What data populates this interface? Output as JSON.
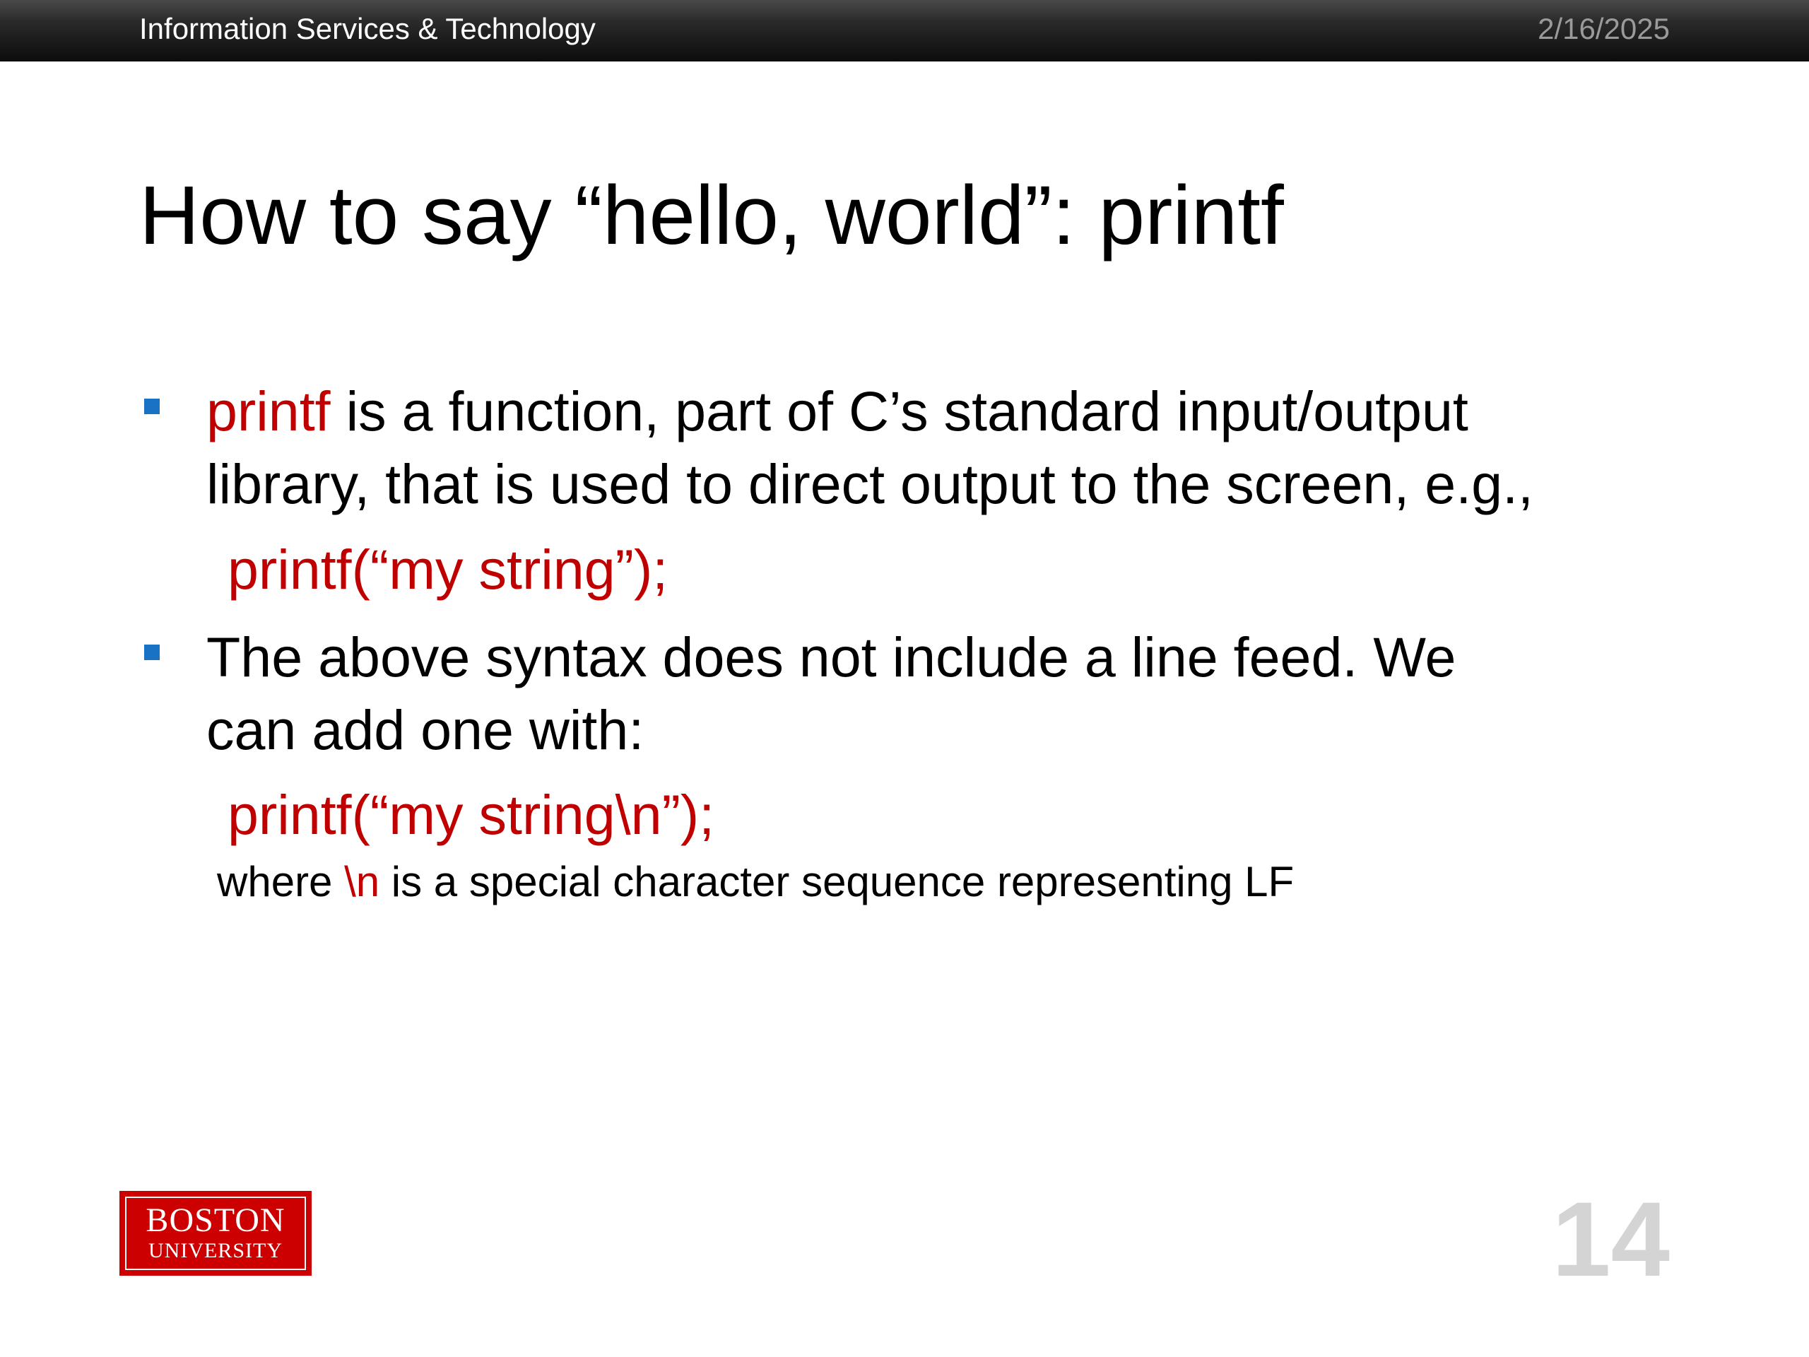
{
  "header": {
    "org_name": "Information Services & Technology",
    "date": "2/16/2025"
  },
  "title": "How to say “hello, world”: printf",
  "bullets": [
    {
      "keyword": "printf",
      "line1_rest": " is a function, part of C’s standard input/output",
      "line2": "library, that is used to direct output to the screen, e.g.,",
      "code": "printf(“my string”);"
    },
    {
      "line1": "The above syntax does not include a line feed.  We",
      "line2": "can add one with:",
      "code": "printf(“my string\\n”);"
    }
  ],
  "note": {
    "prefix": "where ",
    "keyword": "\\n",
    "suffix": " is a special character sequence representing LF"
  },
  "logo": {
    "line1": "BOSTON",
    "line2": "UNIVERSITY"
  },
  "page_number": "14",
  "colors": {
    "accent_red": "#c00000",
    "bullet_blue": "#1a72c5",
    "logo_red": "#cc0000"
  }
}
